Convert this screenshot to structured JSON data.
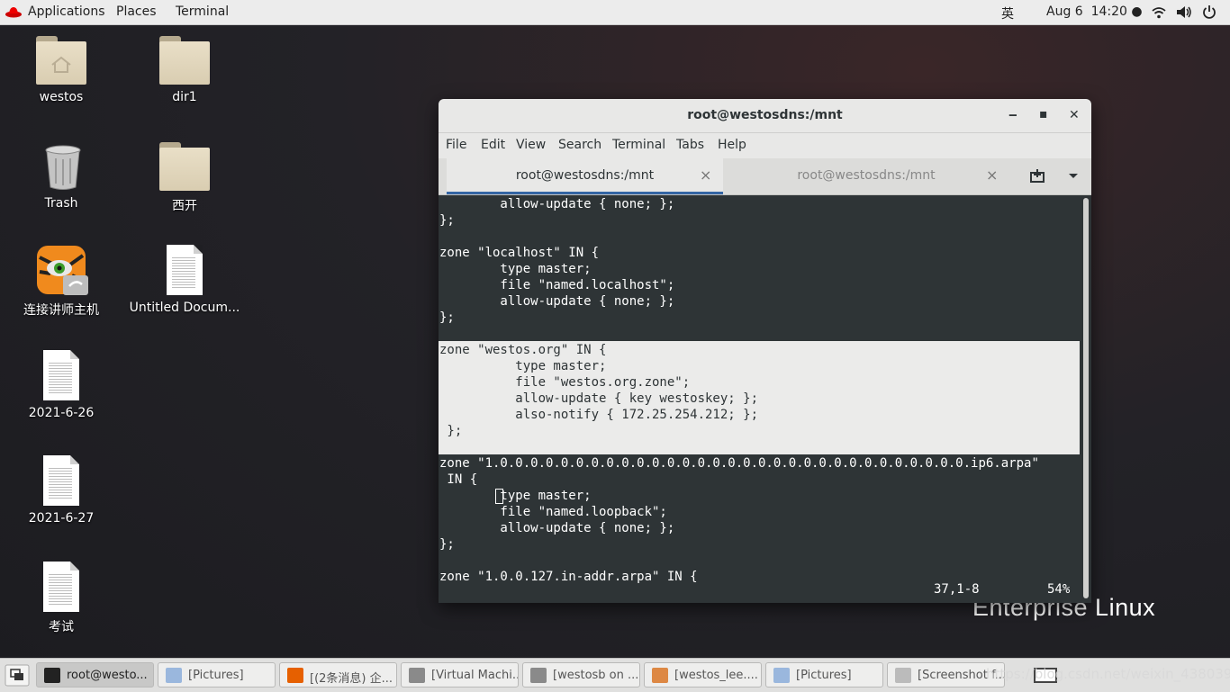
{
  "topbar": {
    "applications": "Applications",
    "places": "Places",
    "terminal": "Terminal",
    "input_method": "英",
    "datetime": "Aug 6  14:20 ●"
  },
  "desktop": {
    "icons": [
      {
        "label": "westos",
        "kind": "home-folder"
      },
      {
        "label": "dir1",
        "kind": "folder"
      },
      {
        "label": "Trash",
        "kind": "trash"
      },
      {
        "label": "西开",
        "kind": "folder"
      },
      {
        "label": "连接讲师主机",
        "kind": "launcher"
      },
      {
        "label": "Untitled Docum...",
        "kind": "document"
      },
      {
        "label": "2021-6-26",
        "kind": "document"
      },
      {
        "label": "2021-6-27",
        "kind": "document"
      },
      {
        "label": "考试",
        "kind": "document"
      }
    ],
    "brand": "Enterprise Linux"
  },
  "window": {
    "title": "root@westosdns:/mnt",
    "menu": [
      "File",
      "Edit",
      "View",
      "Search",
      "Terminal",
      "Tabs",
      "Help"
    ],
    "tabs": [
      {
        "label": "root@westosdns:/mnt",
        "active": true
      },
      {
        "label": "root@westosdns:/mnt",
        "active": false
      }
    ],
    "terminal_lines": [
      "        allow-update { none; };",
      "};",
      "",
      "zone \"localhost\" IN {",
      "        type master;",
      "        file \"named.localhost\";",
      "        allow-update { none; };",
      "};",
      "",
      "zone \"westos.org\" IN {",
      "          type master;",
      "          file \"westos.org.zone\";",
      "          allow-update { key westoskey; };",
      "          also-notify { 172.25.254.212; };",
      " };",
      "",
      "zone \"1.0.0.0.0.0.0.0.0.0.0.0.0.0.0.0.0.0.0.0.0.0.0.0.0.0.0.0.0.0.0.0.ip6.arpa\"",
      " IN {",
      "        type master;",
      "        file \"named.loopback\";",
      "        allow-update { none; };",
      "};",
      "",
      "zone \"1.0.0.127.in-addr.arpa\" IN {"
    ],
    "status_position": "37,1-8",
    "status_percent": "54%"
  },
  "taskbar": {
    "items": [
      {
        "label": "root@westo...",
        "active": true
      },
      {
        "label": "[Pictures]",
        "active": false
      },
      {
        "label": "[(2条消息) 企...",
        "active": false
      },
      {
        "label": "[Virtual Machi...",
        "active": false
      },
      {
        "label": "[westosb on ...",
        "active": false
      },
      {
        "label": "[westos_lee....",
        "active": false
      },
      {
        "label": "[Pictures]",
        "active": false
      },
      {
        "label": "[Screenshot f...",
        "active": false
      }
    ],
    "watermark": "https://blog.csdn.net/weixin_43803940"
  }
}
